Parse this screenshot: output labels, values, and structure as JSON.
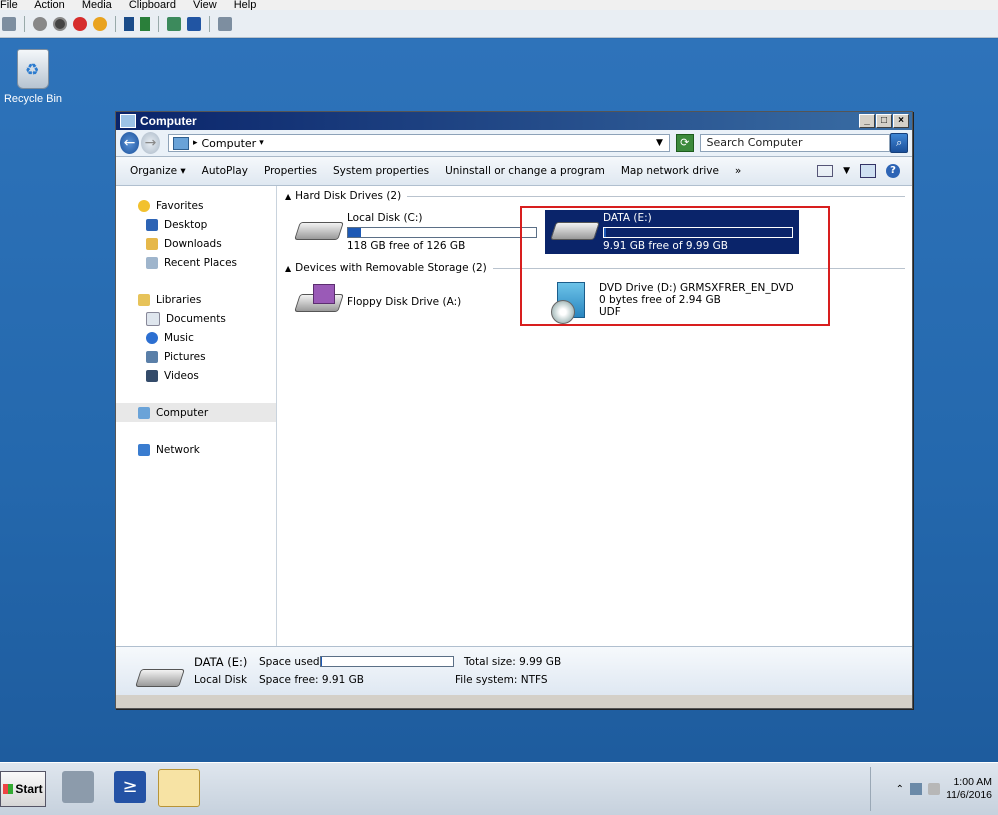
{
  "host": {
    "menu": [
      "File",
      "Action",
      "Media",
      "Clipboard",
      "View",
      "Help"
    ]
  },
  "desktop": {
    "recycle_bin_label": "Recycle Bin"
  },
  "window": {
    "title": "Computer",
    "controls": [
      "_",
      "□",
      "×"
    ],
    "address": {
      "path": "Computer",
      "arrow": "▸"
    },
    "search_placeholder": "Search Computer",
    "commands": [
      "Organize ▾",
      "AutoPlay",
      "Properties",
      "System properties",
      "Uninstall or change a program",
      "Map network drive",
      "»"
    ],
    "nav": {
      "favorites": {
        "label": "Favorites",
        "items": [
          "Desktop",
          "Downloads",
          "Recent Places"
        ]
      },
      "libraries": {
        "label": "Libraries",
        "items": [
          "Documents",
          "Music",
          "Pictures",
          "Videos"
        ]
      },
      "computer": "Computer",
      "network": "Network"
    },
    "groups": {
      "hdd": "Hard Disk Drives (2)",
      "removable": "Devices with Removable Storage (2)"
    },
    "drives": {
      "c": {
        "name": "Local Disk (C:)",
        "free": "118 GB free of 126 GB",
        "used_fraction": 0.07
      },
      "e": {
        "name": "DATA (E:)",
        "free": "9.91 GB free of 9.99 GB",
        "used_fraction": 0.01
      },
      "a": {
        "name": "Floppy Disk Drive (A:)"
      },
      "d": {
        "name": "DVD Drive (D:) GRMSXFRER_EN_DVD",
        "free": "0 bytes free of 2.94 GB",
        "fs": "UDF"
      }
    },
    "details": {
      "name": "DATA (E:)",
      "type": "Local Disk",
      "space_used_label": "Space used:",
      "space_free": "Space free: 9.91 GB",
      "total_size": "Total size: 9.99 GB",
      "file_system": "File system: NTFS"
    }
  },
  "taskbar": {
    "start_label": "Start",
    "time": "1:00 AM",
    "date": "11/6/2016"
  },
  "colors": {
    "desktop": "#2468ad",
    "highlight_box": "#d81e1e",
    "selection": "#0a246a"
  }
}
